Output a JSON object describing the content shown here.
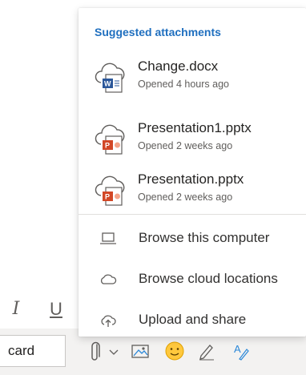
{
  "compose": {
    "format_italic": "I",
    "format_underline": "U",
    "discard_label": "card"
  },
  "attachments_menu": {
    "heading": "Suggested attachments",
    "accent_color": "#1f6fbf",
    "suggested": [
      {
        "name": "Change.docx",
        "opened": "Opened 4 hours ago",
        "type": "word-icon"
      },
      {
        "name": "Presentation1.pptx",
        "opened": "Opened 2 weeks ago",
        "type": "powerpoint-icon"
      },
      {
        "name": "Presentation.pptx",
        "opened": "Opened 2 weeks ago",
        "type": "powerpoint-icon"
      }
    ],
    "actions": [
      {
        "label": "Browse this computer",
        "icon": "computer-icon"
      },
      {
        "label": "Browse cloud locations",
        "icon": "cloud-icon"
      },
      {
        "label": "Upload and share",
        "icon": "cloud-upload-icon"
      }
    ]
  },
  "toolbar": {
    "icons": [
      "paperclip-icon",
      "chevron-down-icon",
      "image-icon",
      "emoji-icon",
      "signature-icon",
      "editor-icon"
    ]
  }
}
